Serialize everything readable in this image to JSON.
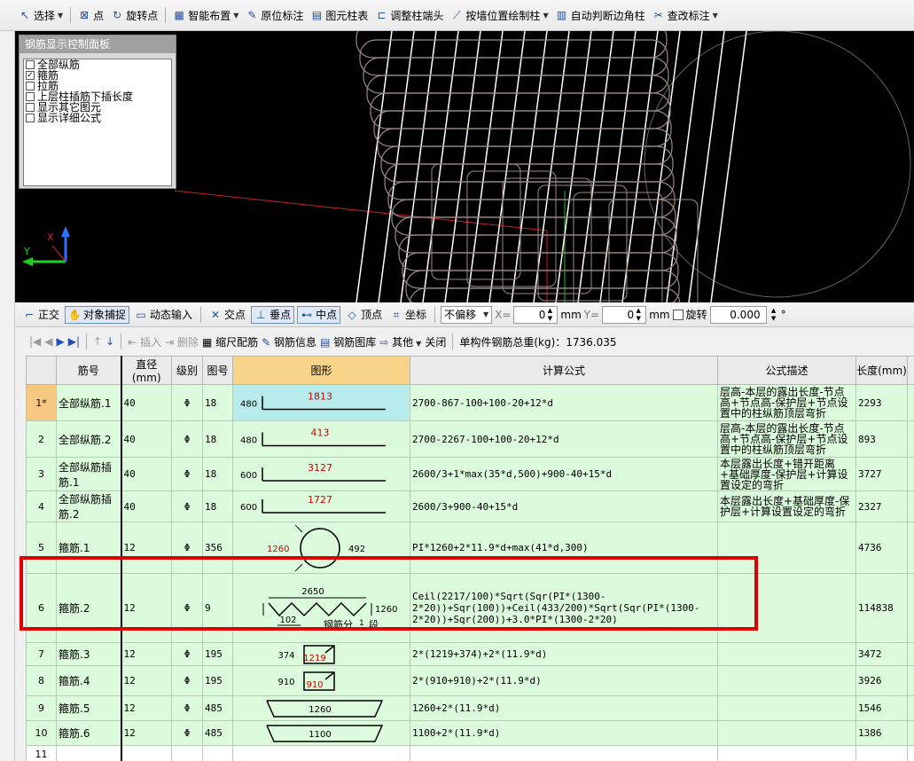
{
  "toolbar": {
    "items": [
      {
        "label": "选择",
        "icon": "arrow-cursor-icon",
        "dropdown": true
      },
      {
        "label": "点",
        "icon": "point-icon",
        "dropdown": false
      },
      {
        "label": "旋转点",
        "icon": "rotate-point-icon",
        "dropdown": false
      },
      {
        "label": "智能布置",
        "icon": "smart-layout-icon",
        "dropdown": true
      },
      {
        "label": "原位标注",
        "icon": "in-place-annotation-icon",
        "dropdown": false
      },
      {
        "label": "图元柱表",
        "icon": "column-table-icon",
        "dropdown": false
      },
      {
        "label": "调整柱端头",
        "icon": "adjust-column-end-icon",
        "dropdown": false
      },
      {
        "label": "按墙位置绘制柱",
        "icon": "draw-column-by-wall-icon",
        "dropdown": true
      },
      {
        "label": "自动判断边角柱",
        "icon": "auto-corner-column-icon",
        "dropdown": false
      },
      {
        "label": "查改标注",
        "icon": "edit-annotation-icon",
        "dropdown": true
      }
    ]
  },
  "control_panel": {
    "title": "钢筋显示控制面板",
    "options": [
      {
        "label": "全部纵筋",
        "checked": false
      },
      {
        "label": "箍筋",
        "checked": true
      },
      {
        "label": "拉筋",
        "checked": false
      },
      {
        "label": "上层柱插筋下插长度",
        "checked": false
      },
      {
        "label": "显示其它图元",
        "checked": false
      },
      {
        "label": "显示详细公式",
        "checked": false
      }
    ]
  },
  "axes": {
    "x": "X",
    "y": "Y"
  },
  "snapbar": {
    "ortho": "正交",
    "object_snap": "对象捕捉",
    "dynamic_input": "动态输入",
    "intersection": "交点",
    "perpendicular": "垂点",
    "midpoint": "中点",
    "vertex": "顶点",
    "coordinate": "坐标",
    "offset_mode": "不偏移",
    "x_label": "X=",
    "x_value": "0",
    "x_unit": "mm",
    "y_label": "Y=",
    "y_value": "0",
    "y_unit": "mm",
    "rotate_label": "旋转",
    "rotate_value": "0.000",
    "degree": "°"
  },
  "gridbar": {
    "insert": "插入",
    "delete": "删除",
    "scale_rebar": "缩尺配筋",
    "rebar_info": "钢筋信息",
    "rebar_library": "钢筋图库",
    "other": "其他",
    "close": "关闭",
    "total_label": "单构件钢筋总重(kg)：1736.035"
  },
  "table": {
    "headers": [
      "",
      "筋号",
      "直径(mm)",
      "级别",
      "图号",
      "图形",
      "计算公式",
      "公式描述",
      "长度(mm)",
      ""
    ],
    "rows": [
      {
        "no": "1*",
        "name": "全部纵筋.1",
        "dia": "40",
        "grade": "Φ",
        "fig": "18",
        "shape": "L",
        "s_left": "480",
        "s_main": "1813",
        "formula": "2700-867-100+100-20+12*d",
        "desc": "层高-本层的露出长度-节点高+节点高-保护层+节点设置中的柱纵筋顶层弯折",
        "len": "2293"
      },
      {
        "no": "2",
        "name": "全部纵筋.2",
        "dia": "40",
        "grade": "Φ",
        "fig": "18",
        "shape": "L",
        "s_left": "480",
        "s_main": "413",
        "formula": "2700-2267-100+100-20+12*d",
        "desc": "层高-本层的露出长度-节点高+节点高-保护层+节点设置中的柱纵筋顶层弯折",
        "len": "893"
      },
      {
        "no": "3",
        "name": "全部纵筋插筋.1",
        "dia": "40",
        "grade": "Φ",
        "fig": "18",
        "shape": "L",
        "s_left": "600",
        "s_main": "3127",
        "formula": "2600/3+1*max(35*d,500)+900-40+15*d",
        "desc": "本层露出长度+错开距离+基础厚度-保护层+计算设置设定的弯折",
        "len": "3727"
      },
      {
        "no": "4",
        "name": "全部纵筋插筋.2",
        "dia": "40",
        "grade": "Φ",
        "fig": "18",
        "shape": "L",
        "s_left": "600",
        "s_main": "1727",
        "formula": "2600/3+900-40+15*d",
        "desc": "本层露出长度+基础厚度-保护层+计算设置设定的弯折",
        "len": "2327"
      },
      {
        "no": "5",
        "name": "箍筋.1",
        "dia": "12",
        "grade": "Φ",
        "fig": "356",
        "shape": "circle",
        "s_left": "1260",
        "s_main": "492",
        "formula": "PI*1260+2*11.9*d+max(41*d,300)",
        "desc": "",
        "len": "4736"
      },
      {
        "no": "6",
        "name": "箍筋.2",
        "dia": "12",
        "grade": "Φ",
        "fig": "9",
        "shape": "spiral",
        "s_top": "2650",
        "s_right": "1260",
        "s_pitch": "102",
        "s_seg_prefix": "钢筋分",
        "s_seg_num": "1",
        "s_seg_suffix": "段",
        "formula": "Ceil(2217/100)*Sqrt(Sqr(PI*(1300-2*20))+Sqr(100))+Ceil(433/200)*Sqrt(Sqr(PI*(1300-2*20))+Sqr(200))+3.0*PI*(1300-2*20)",
        "desc": "",
        "len": "114838"
      },
      {
        "no": "7",
        "name": "箍筋.3",
        "dia": "12",
        "grade": "Φ",
        "fig": "195",
        "shape": "hook",
        "s_left": "374",
        "s_main": "1219",
        "formula": "2*(1219+374)+2*(11.9*d)",
        "desc": "",
        "len": "3472"
      },
      {
        "no": "8",
        "name": "箍筋.4",
        "dia": "12",
        "grade": "Φ",
        "fig": "195",
        "shape": "hook",
        "s_left": "910",
        "s_main": "910",
        "formula": "2*(910+910)+2*(11.9*d)",
        "desc": "",
        "len": "3926"
      },
      {
        "no": "9",
        "name": "箍筋.5",
        "dia": "12",
        "grade": "Φ",
        "fig": "485",
        "shape": "tie",
        "s_main": "1260",
        "formula": "1260+2*(11.9*d)",
        "desc": "",
        "len": "1546"
      },
      {
        "no": "10",
        "name": "箍筋.6",
        "dia": "12",
        "grade": "Φ",
        "fig": "485",
        "shape": "tie",
        "s_main": "1100",
        "formula": "1100+2*(11.9*d)",
        "desc": "",
        "len": "1386"
      },
      {
        "no": "11",
        "name": "",
        "dia": "",
        "grade": "",
        "fig": "",
        "shape": "none",
        "formula": "",
        "desc": "",
        "len": ""
      }
    ]
  },
  "colors": {
    "row_bg": "#dcfadc",
    "selected_row_no": "#f7c880",
    "shape_header": "#f7d488",
    "highlight_box": "#e00000",
    "dimension_red": "#d00000"
  }
}
